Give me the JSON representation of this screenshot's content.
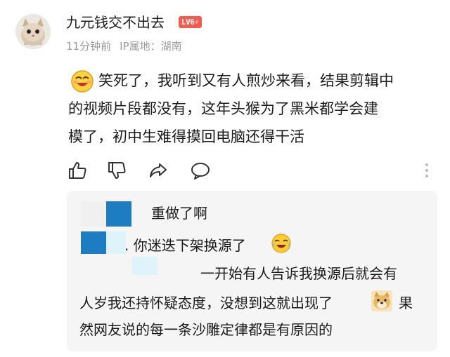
{
  "user": {
    "name": "九元钱交不出去",
    "level_badge": "LV6⚡",
    "time_ago": "11分钟前",
    "ip_location": "IP属地：湖南"
  },
  "comment": {
    "lines": [
      "笑死了，我听到又有人煎炒来看，结果剪辑中",
      "的视频片段都没有，这年头猴为了黑米都学会建",
      "模了，初中生难得摸回电脑还得干活"
    ],
    "emoji": "laughing-face-icon"
  },
  "actions": [
    {
      "name": "like-button",
      "icon": "thumbs-up-icon"
    },
    {
      "name": "dislike-button",
      "icon": "thumbs-down-icon"
    },
    {
      "name": "share-button",
      "icon": "share-arrow-icon"
    },
    {
      "name": "reply-button",
      "icon": "speech-bubble-icon"
    }
  ],
  "replies": [
    {
      "text": "重做了啊"
    },
    {
      "text": ". 你迷迭下架换源了"
    },
    {
      "lines": [
        "一开始有人告诉我换源后就会有",
        "人岁我还持怀疑态度，没想到这就出现了",
        "果",
        "然网友说的每一条沙雕定律都是有原因的"
      ]
    }
  ],
  "colors": {
    "badge": "#f55a4e",
    "meta_text": "#9a9a9a",
    "reply_bg": "#f5f5f5",
    "mosaic_blue": "#1e7cc2",
    "mosaic_light": "#dff3fb"
  }
}
